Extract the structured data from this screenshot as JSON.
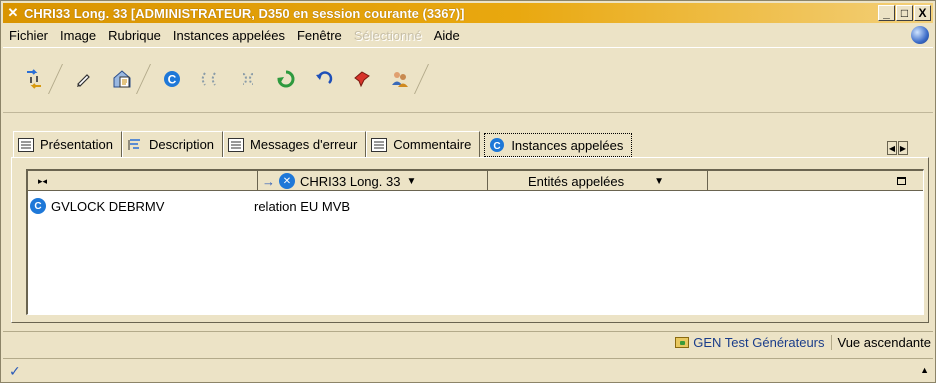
{
  "window": {
    "title": "CHRI33 Long. 33 [ADMINISTRATEUR, D350 en session courante (3367)]",
    "title_icon": "close-x-icon",
    "buttons": [
      "_",
      "□",
      "X"
    ]
  },
  "menu": {
    "items": [
      {
        "label": "Fichier",
        "disabled": false
      },
      {
        "label": "Image",
        "disabled": false
      },
      {
        "label": "Rubrique",
        "disabled": false
      },
      {
        "label": "Instances appelées",
        "disabled": false
      },
      {
        "label": "Fenêtre",
        "disabled": false
      },
      {
        "label": "Sélectionné",
        "disabled": true
      },
      {
        "label": "Aide",
        "disabled": false
      }
    ]
  },
  "toolbar": {
    "icons": [
      "transfer-icon",
      "pencil-icon",
      "home-document-icon",
      "gen-c-icon",
      "cut-icon",
      "replace-icon",
      "refresh-icon",
      "undo-icon",
      "pin-icon",
      "users-icon"
    ]
  },
  "tabs": [
    {
      "label": "Présentation",
      "icon": "list-icon",
      "active": false
    },
    {
      "label": "Description",
      "icon": "tree-icon",
      "active": false
    },
    {
      "label": "Messages d'erreur",
      "icon": "list-icon",
      "active": false
    },
    {
      "label": "Commentaire",
      "icon": "list-icon",
      "active": false
    },
    {
      "label": "Instances appelées",
      "icon": "gen-c-icon",
      "active": true
    }
  ],
  "list": {
    "header": {
      "col1_icon": "collapse-icon",
      "col2_label": "CHRI33 Long. 33",
      "col3_label": "Entités appelées"
    },
    "rows": [
      {
        "name": "GVLOCK DEBRMV",
        "relation": "relation EU  MVB"
      }
    ]
  },
  "status": {
    "gen_label": "GEN Test Générateurs",
    "view_label": "Vue ascendante"
  },
  "colors": {
    "title_gradient_start": "#d99400",
    "background": "#ece3c6",
    "accent_blue": "#2a6fd6"
  }
}
